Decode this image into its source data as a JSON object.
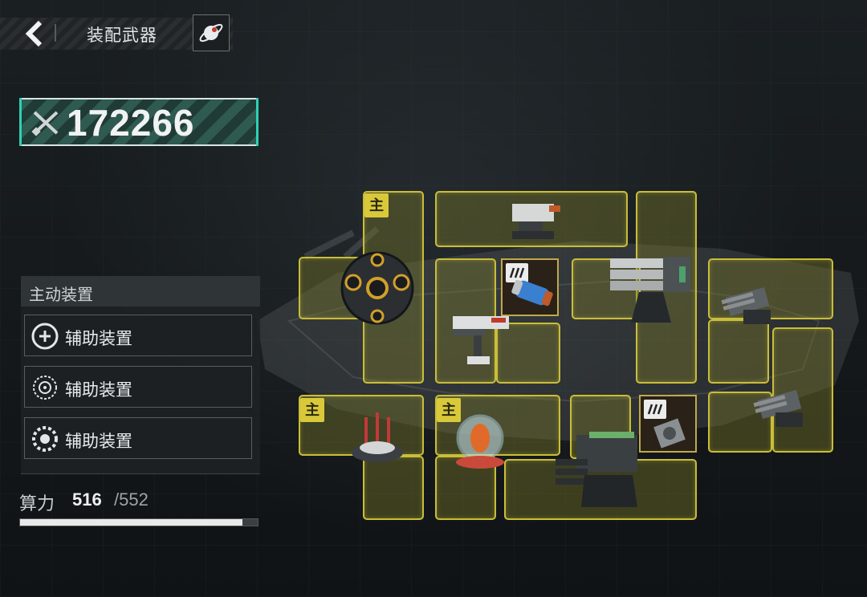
{
  "header": {
    "title": "装配武器",
    "back_icon": "chevron-left-icon",
    "action_icon": "planet-icon"
  },
  "power": {
    "value": "172266",
    "icon": "crossed-swords-icon"
  },
  "panel": {
    "heading": "主动装置",
    "slots": [
      {
        "label": "辅助装置",
        "icon": "shield-cross-icon"
      },
      {
        "label": "辅助装置",
        "icon": "target-scope-icon"
      },
      {
        "label": "辅助装置",
        "icon": "ring-gear-icon"
      }
    ]
  },
  "compute": {
    "label": "算力",
    "used": "516",
    "max": "/552",
    "fill_fraction": 0.935
  },
  "grid": {
    "main_tag": "主",
    "equipment": [
      "sphere-core-module",
      "heavy-cannon-turret",
      "railgun-turret",
      "gatling-turret",
      "twin-barrel-turret-upper",
      "twin-barrel-turret-lower",
      "missile-spire-module",
      "energy-capsule-module",
      "heavy-missile-launcher",
      "ammo-canister",
      "ammo-chip"
    ]
  },
  "colors": {
    "accent_teal": "#2fd1b4",
    "slot_yellow": "#c9bd3a",
    "tag_yellow": "#d9c93a"
  }
}
